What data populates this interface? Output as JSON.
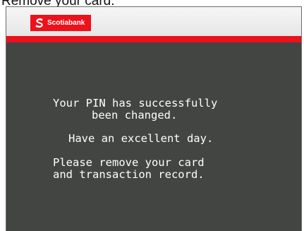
{
  "caption": "Remove your card.",
  "header": {
    "brand_name": "Scotiabank",
    "brand_color": "#ec111a",
    "logo_icon": "scotiabank-s-icon"
  },
  "messages": {
    "pin_changed_line1": "Your PIN has successfully",
    "pin_changed_line2": "been changed.",
    "greeting": "Have an excellent day.",
    "remove_line1": "Please remove your card",
    "remove_line2": "and transaction record."
  },
  "colors": {
    "screen_background": "#434543",
    "header_background": "#f0f0f0",
    "accent_red": "#ec111a",
    "text": "#ffffff"
  }
}
